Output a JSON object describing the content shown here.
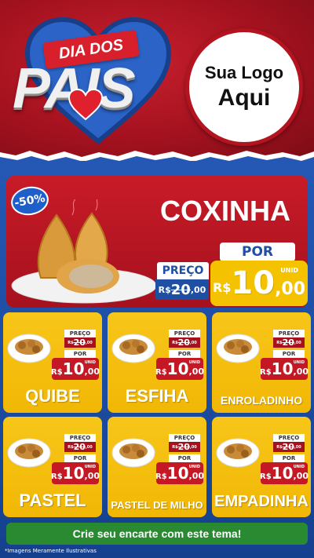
{
  "header": {
    "ribbon_text": "DIA DOS",
    "big_text": "PAIS",
    "logo_line1": "Sua Logo",
    "logo_line2": "Aqui"
  },
  "featured": {
    "discount": "-50%",
    "name": "COXINHA",
    "preco_label": "PREÇO",
    "old_currency": "R$",
    "old_int": "20",
    "old_dec": ",00",
    "por_label": "POR",
    "unid_label": "UNID",
    "new_currency": "R$",
    "new_int": "10",
    "new_dec": ",00"
  },
  "cards": [
    {
      "name": "QUIBE",
      "preco_label": "PREÇO",
      "old_currency": "R$",
      "old_int": "20",
      "old_dec": ",00",
      "por_label": "POR",
      "unid": "UNID",
      "new_currency": "R$",
      "new_int": "10",
      "new_dec": ",00"
    },
    {
      "name": "ESFIHA",
      "preco_label": "PREÇO",
      "old_currency": "R$",
      "old_int": "20",
      "old_dec": ",00",
      "por_label": "POR",
      "unid": "UNID",
      "new_currency": "R$",
      "new_int": "10",
      "new_dec": ",00"
    },
    {
      "name": "ENROLADINHO",
      "preco_label": "PREÇO",
      "old_currency": "R$",
      "old_int": "20",
      "old_dec": ",00",
      "por_label": "POR",
      "unid": "UNID",
      "new_currency": "R$",
      "new_int": "10",
      "new_dec": ",00"
    },
    {
      "name": "PASTEL",
      "preco_label": "PREÇO",
      "old_currency": "R$",
      "old_int": "20",
      "old_dec": ",00",
      "por_label": "POR",
      "unid": "UNID",
      "new_currency": "R$",
      "new_int": "10",
      "new_dec": ",00"
    },
    {
      "name": "PASTEL DE MILHO",
      "preco_label": "PREÇO",
      "old_currency": "R$",
      "old_int": "20",
      "old_dec": ",00",
      "por_label": "POR",
      "unid": "UNID",
      "new_currency": "R$",
      "new_int": "10",
      "new_dec": ",00"
    },
    {
      "name": "EMPADINHA",
      "preco_label": "PREÇO",
      "old_currency": "R$",
      "old_int": "20",
      "old_dec": ",00",
      "por_label": "POR",
      "unid": "UNID",
      "new_currency": "R$",
      "new_int": "10",
      "new_dec": ",00"
    }
  ],
  "cta": {
    "label": "Crie seu encarte com este tema!"
  },
  "disclaimer": "*Imagens Meramente Ilustrativas",
  "colors": {
    "red": "#c81b28",
    "blue": "#1e4fa3",
    "yellow": "#f5c200",
    "green": "#2a8a32"
  },
  "icons": {
    "heart": "heart-icon",
    "food": "food-plate-image"
  }
}
